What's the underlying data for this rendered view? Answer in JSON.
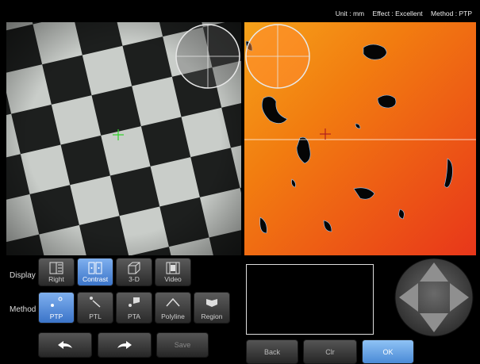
{
  "status": {
    "unit": "Unit : mm",
    "effect": "Effect : Excellent",
    "method": "Method : PTP"
  },
  "display": {
    "label": "Display",
    "items": [
      {
        "label": "Right",
        "icon": "right-view-icon",
        "active": false
      },
      {
        "label": "Contrast",
        "icon": "contrast-icon",
        "active": true
      },
      {
        "label": "3-D",
        "icon": "3d-cube-icon",
        "active": false
      },
      {
        "label": "Video",
        "icon": "film-icon",
        "active": false
      }
    ]
  },
  "method": {
    "label": "Method",
    "items": [
      {
        "label": "PTP",
        "icon": "point-to-point-icon",
        "active": true
      },
      {
        "label": "PTL",
        "icon": "point-to-line-icon",
        "active": false
      },
      {
        "label": "PTA",
        "icon": "point-to-area-icon",
        "active": false
      },
      {
        "label": "Polyline",
        "icon": "polyline-icon",
        "active": false
      },
      {
        "label": "Region",
        "icon": "region-icon",
        "active": false
      }
    ]
  },
  "actions": {
    "undo_icon": "undo-arrow-icon",
    "redo_icon": "redo-arrow-icon",
    "save": "Save"
  },
  "footer": {
    "back": "Back",
    "clr": "Clr",
    "ok": "OK"
  },
  "colors": {
    "accent": "#4a8ad6",
    "depth_map": "#f26a0c",
    "left_cursor": "#31d12a",
    "right_cursor": "#c0392b"
  }
}
